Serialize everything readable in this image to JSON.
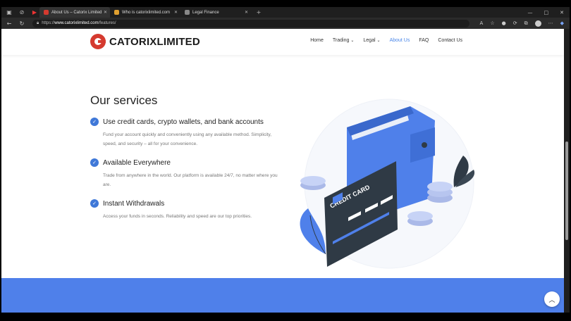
{
  "browser": {
    "tabs": [
      {
        "label": "About Us – Catorix Limited",
        "active": true
      },
      {
        "label": "Who is catorixlimited.com",
        "active": false
      },
      {
        "label": "Legal Finance",
        "active": false
      }
    ],
    "url_prefix": "https://",
    "url_domain": "www.catorixlimited.com",
    "url_path": "/features/"
  },
  "site": {
    "logo_text": "CATORIXLIMITED",
    "nav": [
      {
        "label": "Home",
        "dropdown": false,
        "active": false
      },
      {
        "label": "Trading",
        "dropdown": true,
        "active": false
      },
      {
        "label": "Legal",
        "dropdown": true,
        "active": false
      },
      {
        "label": "About Us",
        "dropdown": false,
        "active": true
      },
      {
        "label": "FAQ",
        "dropdown": false,
        "active": false
      },
      {
        "label": "Contact Us",
        "dropdown": false,
        "active": false
      }
    ]
  },
  "services": {
    "heading": "Our services",
    "items": [
      {
        "title": "Use credit cards, crypto wallets, and bank accounts",
        "desc": "Fund your account quickly and conveniently using any available method. Simplicity, speed, and security – all for your convenience."
      },
      {
        "title": "Available Everywhere",
        "desc": "Trade from anywhere in the world. Our platform is available 24/7, no matter where you are."
      },
      {
        "title": "Instant Withdrawals",
        "desc": "Access your funds in seconds. Reliability and speed are our top priorities."
      }
    ]
  },
  "illustration": {
    "card_text": "CREDIT CARD",
    "colors": {
      "primary": "#4f80ea",
      "dark": "#2f3a45",
      "coin": "#c7d3f6"
    }
  }
}
